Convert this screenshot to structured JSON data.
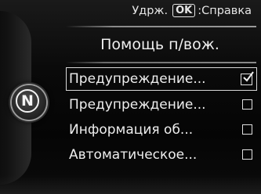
{
  "hint": {
    "hold_text": "Удрж.",
    "key_label": "OK",
    "action_text": ":Справка"
  },
  "header": {
    "title": "Помощь п/вож."
  },
  "gear": {
    "letter": "N"
  },
  "menu": {
    "items": [
      {
        "label": "Предупреждение...",
        "checked": true,
        "selected": true
      },
      {
        "label": "Предупреждение...",
        "checked": false,
        "selected": false
      },
      {
        "label": "Информация об...",
        "checked": false,
        "selected": false
      },
      {
        "label": "Автоматическое...",
        "checked": false,
        "selected": false
      }
    ]
  },
  "icons": {
    "checked": "checkbox-checked-icon",
    "unchecked": "checkbox-empty-icon",
    "gear": "gear-position-indicator-icon"
  }
}
